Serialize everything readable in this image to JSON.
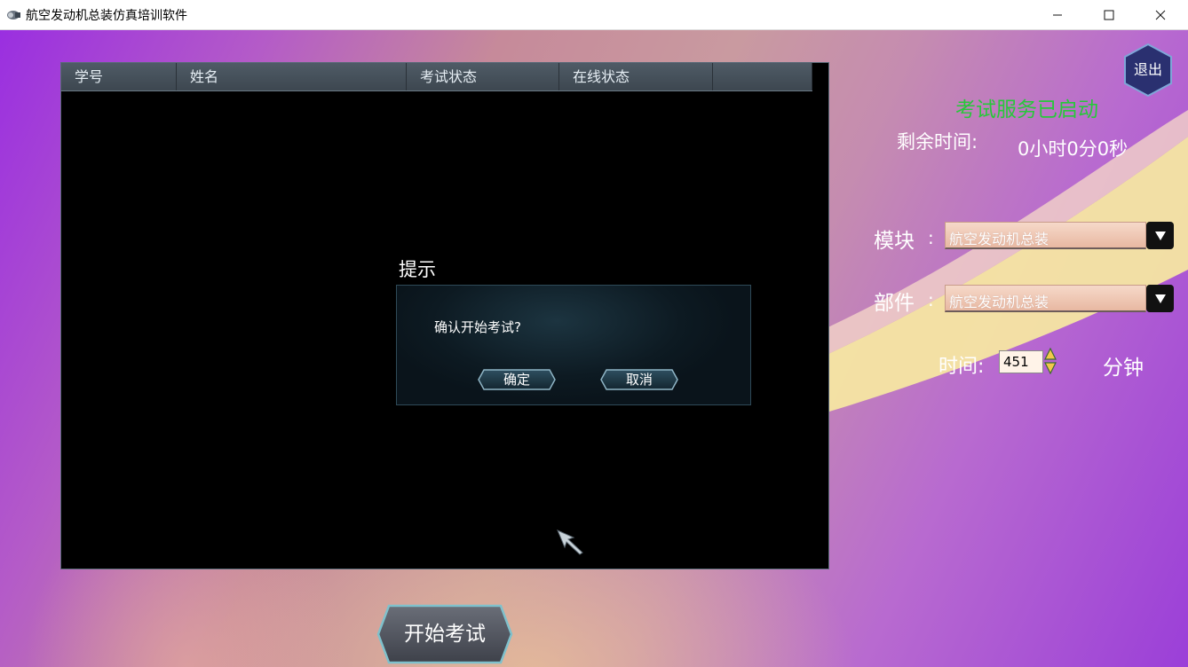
{
  "window": {
    "title": "航空发动机总装仿真培训软件",
    "icon": "engine-icon",
    "controls": [
      "minimize-icon",
      "maximize-icon",
      "close-icon"
    ]
  },
  "table": {
    "columns": [
      "学号",
      "姓名",
      "考试状态",
      "在线状态",
      ""
    ],
    "rows": []
  },
  "dialog": {
    "title": "提示",
    "message": "确认开始考试?",
    "ok_label": "确定",
    "cancel_label": "取消"
  },
  "start_button": {
    "label": "开始考试"
  },
  "exit_button": {
    "label": "退出"
  },
  "status": {
    "service": "考试服务已启动",
    "remaining_label": "剩余时间:",
    "remaining_value": "0小时0分0秒"
  },
  "form": {
    "module_label": "模块",
    "module_value": "航空发动机总装",
    "part_label": "部件",
    "part_value": "航空发动机总装",
    "colon": ":",
    "time_label": "时间:",
    "time_value": "451",
    "time_unit": "分钟"
  },
  "colors": {
    "service_status": "#27c83a",
    "panel_background": "#000000",
    "header_background": "#4a5560"
  }
}
